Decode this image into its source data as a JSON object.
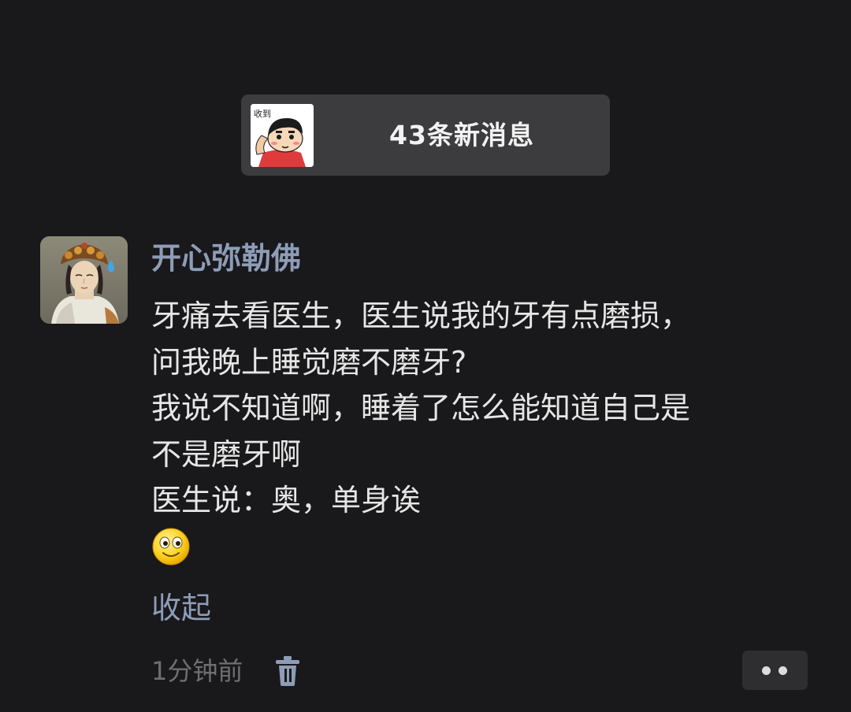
{
  "banner": {
    "thumbnail_icon": "cartoon-boy-sticker",
    "thumbnail_text": "收到",
    "text": "43条新消息"
  },
  "post": {
    "avatar_icon": "bodhisattva-statue-avatar",
    "username": "开心弥勒佛",
    "lines": [
      "牙痛去看医生，医生说我的牙有点磨损，",
      "问我晚上睡觉磨不磨牙?",
      "我说不知道啊，睡着了怎么能知道自己是",
      "不是磨牙啊",
      "医生说：奥，单身诶"
    ],
    "emoji_icon": "smiley-face-emoji",
    "collapse_label": "收起",
    "time": "1分钟前",
    "delete_icon": "trash-icon",
    "more_icon": "more-dots-icon"
  },
  "colors": {
    "background": "#19181a",
    "banner_bg": "#3c3b3e",
    "username": "#8d9db8",
    "body_text": "#e6e6e6",
    "time_text": "#6f6f73"
  }
}
